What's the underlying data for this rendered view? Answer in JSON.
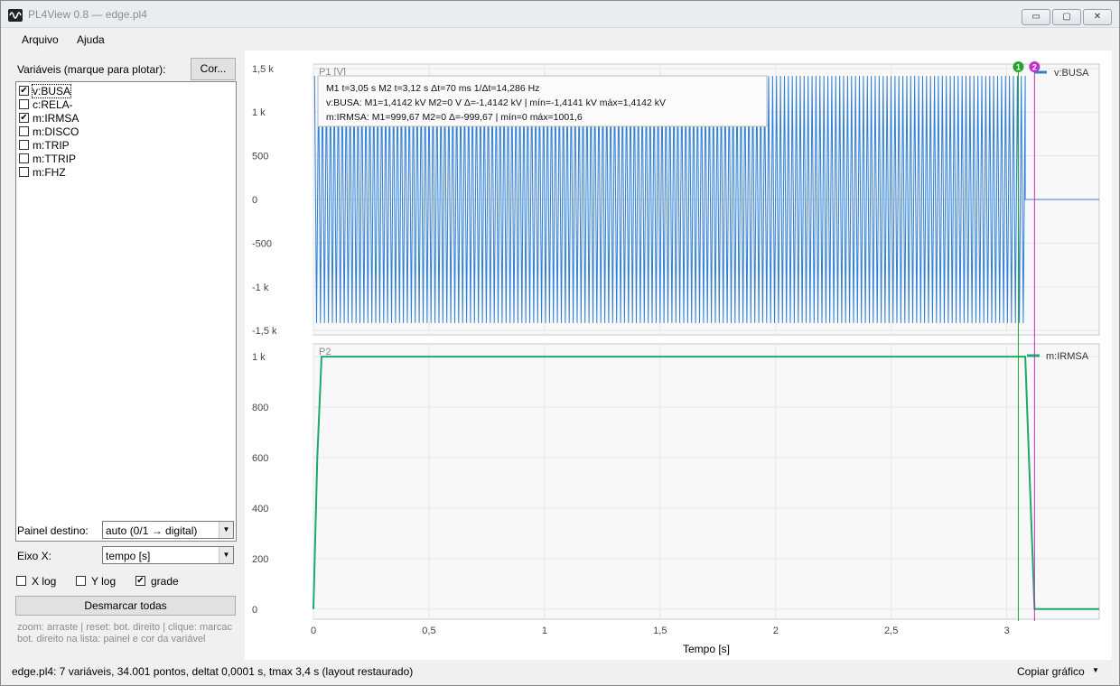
{
  "window": {
    "title": "PL4View 0.8 — edge.pl4",
    "min_glyph": "▭",
    "max_glyph": "▢",
    "close_glyph": "✕"
  },
  "menu": [
    "Arquivo",
    "Ajuda"
  ],
  "sidebar": {
    "variables_label": "Variáveis (marque para plotar):",
    "color_button": "Cor...",
    "variables": [
      {
        "name": "v:BUSA",
        "checked": true,
        "selected": true
      },
      {
        "name": "c:RELA-",
        "checked": false
      },
      {
        "name": "m:IRMSA",
        "checked": true
      },
      {
        "name": "m:DISCO",
        "checked": false
      },
      {
        "name": "m:TRIP",
        "checked": false
      },
      {
        "name": "m:TTRIP",
        "checked": false
      },
      {
        "name": "m:FHZ",
        "checked": false
      }
    ],
    "panel_label": "Painel destino:",
    "panel_value": "auto (0/1 → digital)",
    "xaxis_label": "Eixo X:",
    "xaxis_value": "tempo [s]",
    "xlog_label": "X log",
    "xlog_checked": false,
    "ylog_label": "Y log",
    "ylog_checked": false,
    "grid_label": "grade",
    "grid_checked": true,
    "clear_button": "Desmarcar todas",
    "hint1": "zoom: arraste | reset: bot. direito | clique: marcac",
    "hint2": "bot. direito na lista: painel e cor da variável"
  },
  "status": {
    "text": "edge.pl4: 7 variáveis, 34.001 pontos, deltat 0,0001 s, tmax 3,4 s  (layout restaurado)",
    "copy_button": "Copiar gráfico"
  },
  "chart_data": [
    {
      "type": "line",
      "panel": "P1 [V]",
      "ylim": [
        -1550,
        1550
      ],
      "yticks": [
        1500,
        1000,
        500,
        0,
        -500,
        -1000,
        -1500
      ],
      "ytick_labels": [
        "1,5 k",
        "1 k",
        "500",
        "0",
        "-500",
        "-1 k",
        "-1,5 k"
      ],
      "xlim": [
        0,
        3.4
      ],
      "series": [
        {
          "name": "v:BUSA",
          "color": "#2f7fd6",
          "description_values": {
            "amplitude": 1414.2,
            "frequency_hz": 60,
            "t_end": 3.08
          }
        }
      ],
      "grid": true
    },
    {
      "type": "line",
      "panel": "P2",
      "ylim": [
        -40,
        1050
      ],
      "yticks": [
        1000,
        800,
        600,
        400,
        200,
        0
      ],
      "ytick_labels": [
        "1 k",
        "800",
        "600",
        "400",
        "200",
        "0"
      ],
      "xlim": [
        0,
        3.4
      ],
      "xticks": [
        0,
        0.5,
        1,
        1.5,
        2,
        2.5,
        3
      ],
      "xtick_labels": [
        "0",
        "0,5",
        "1",
        "1,5",
        "2",
        "2,5",
        "3"
      ],
      "xlabel": "Tempo [s]",
      "series": [
        {
          "name": "m:IRMSA",
          "color": "#1aaa6a",
          "x": [
            0,
            0.017,
            0.035,
            3.08,
            3.1,
            3.12,
            3.4
          ],
          "y": [
            0,
            600,
            999.67,
            999.67,
            500,
            0,
            0
          ]
        }
      ],
      "grid": true
    }
  ],
  "markers": [
    {
      "id": "1",
      "t": 3.05,
      "color": "#22a52e"
    },
    {
      "id": "2",
      "t": 3.12,
      "color": "#c030c8"
    }
  ],
  "cursor_box": {
    "line1": "M1 t=3,05 s   M2 t=3,12 s   Δt=70 ms   1/Δt=14,286 Hz",
    "line2": "v:BUSA:  M1=1,4142 kV  M2=0 V  Δ=-1,4142 kV  |  mín=-1,4141 kV  máx=1,4142 kV",
    "line3": "m:IRMSA:  M1=999,67  M2=0  Δ=-999,67  |  mín=0  máx=1001,6"
  }
}
